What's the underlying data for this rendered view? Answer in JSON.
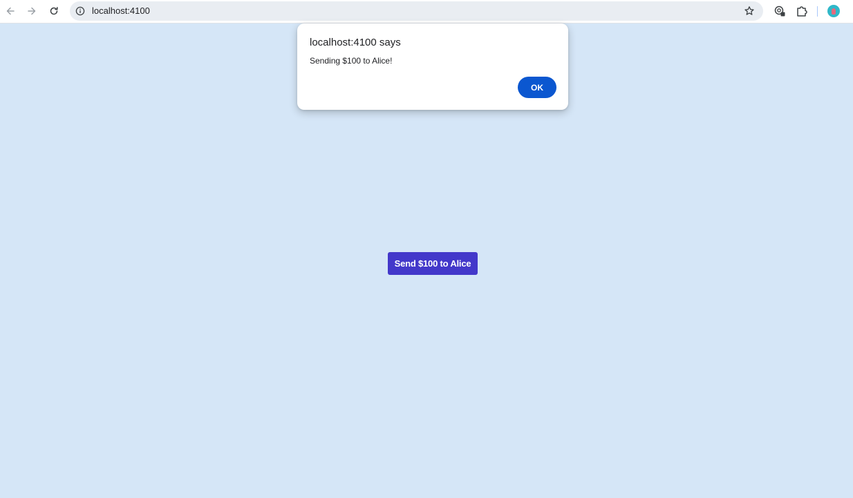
{
  "browser": {
    "url": "localhost:4100",
    "icons": {
      "back": "arrow-left-icon",
      "forward": "arrow-right-icon",
      "reload": "reload-icon",
      "site_info": "info-icon",
      "bookmark": "star-icon",
      "password_manager": "key-icon",
      "extensions": "puzzle-icon",
      "profile": "avatar"
    }
  },
  "dialog": {
    "title": "localhost:4100 says",
    "message": "Sending $100 to Alice!",
    "ok_label": "OK",
    "ok_color": "#0b57d0"
  },
  "page": {
    "background": "#d5e6f7",
    "send_button_label": "Send $100 to Alice",
    "send_button_color": "#4338ca"
  }
}
